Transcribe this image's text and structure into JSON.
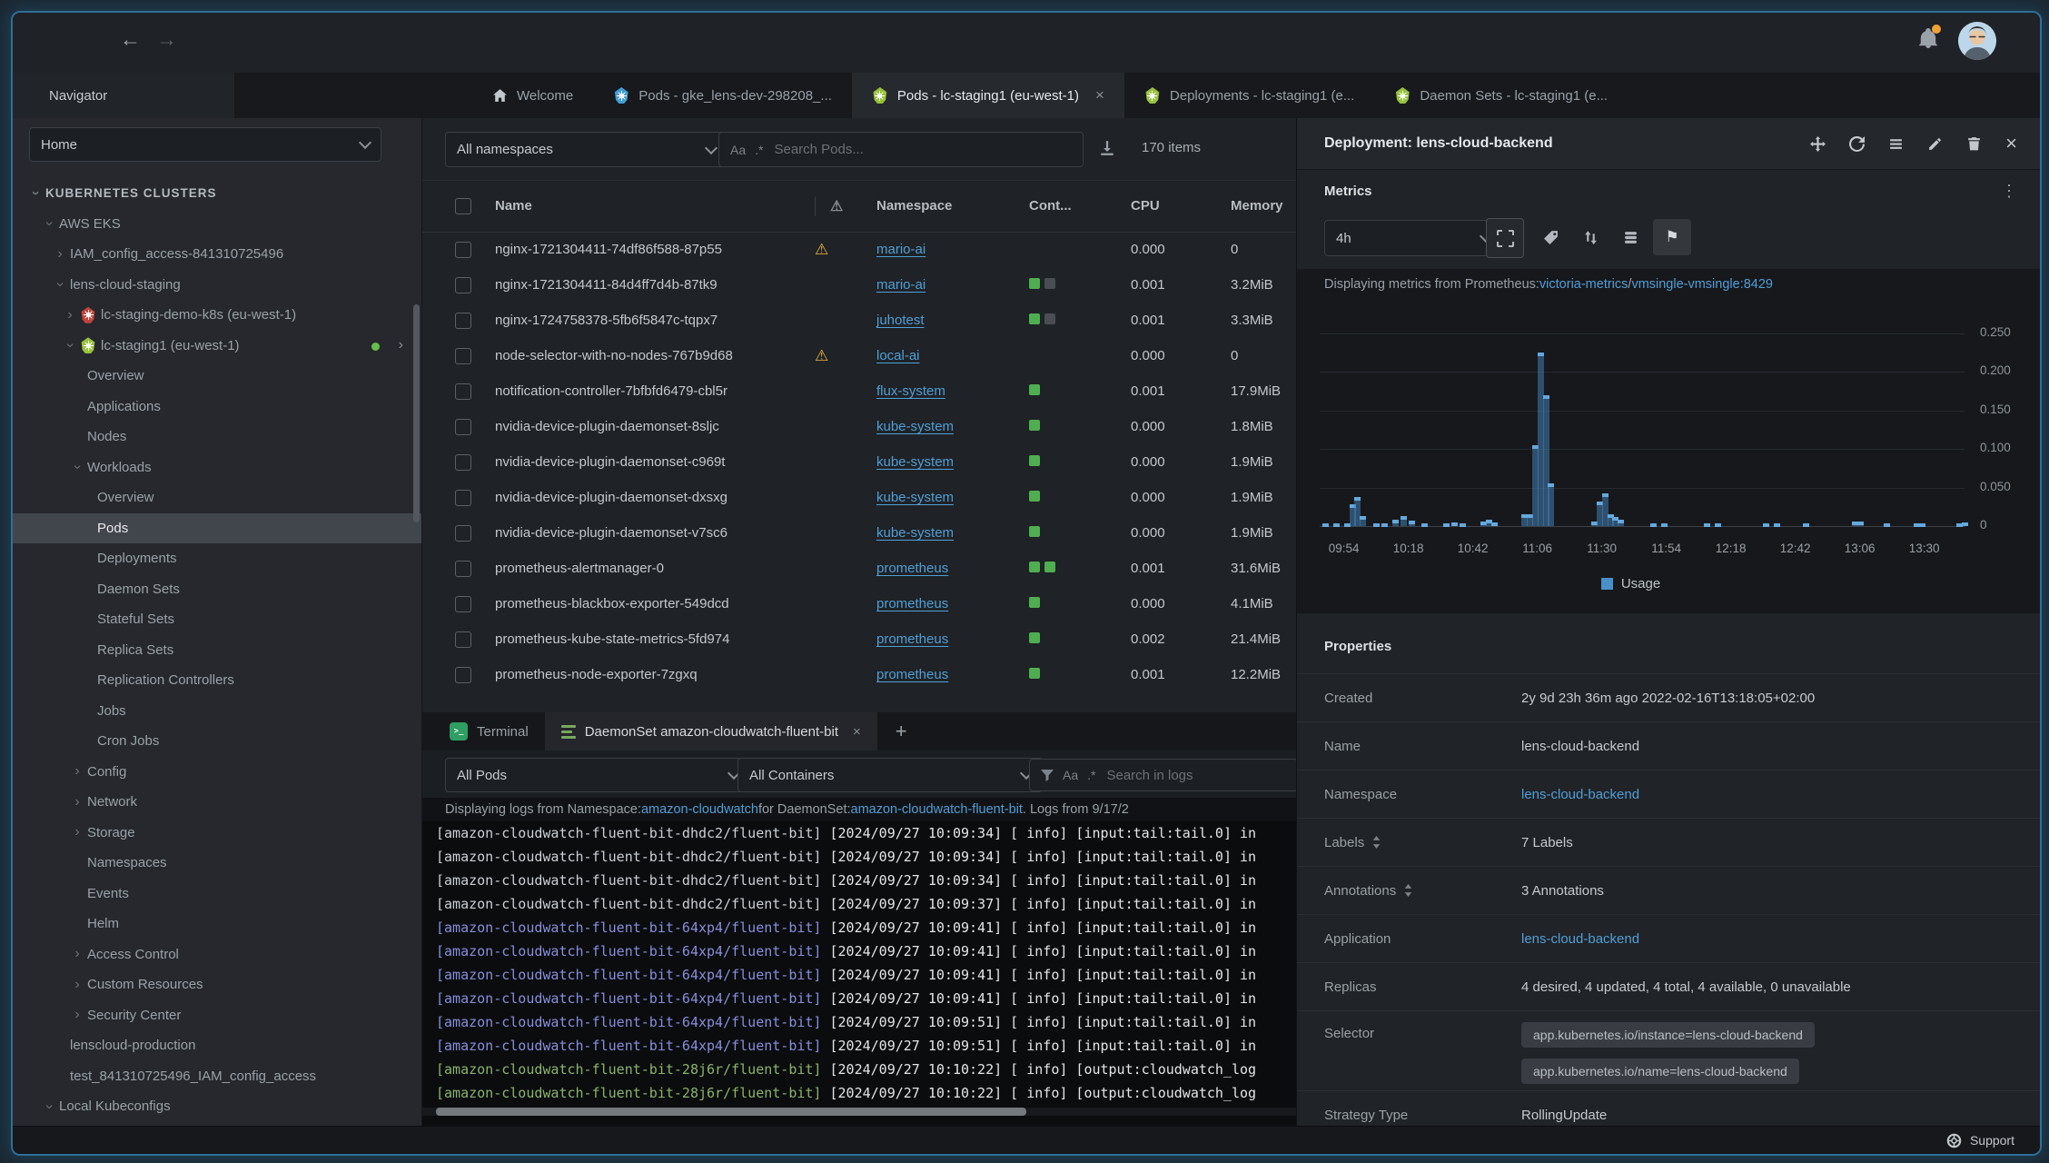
{
  "chart_data": {
    "type": "bar",
    "title": "",
    "xlabel": "",
    "ylabel": "",
    "ylim": [
      0,
      0.25
    ],
    "yticks": [
      "0.250",
      "0.200",
      "0.150",
      "0.100",
      "0.050",
      "0"
    ],
    "ytick_values": [
      0.25,
      0.2,
      0.15,
      0.1,
      0.05,
      0
    ],
    "xticks": [
      "09:54",
      "10:18",
      "10:42",
      "11:06",
      "11:30",
      "11:54",
      "12:18",
      "12:42",
      "13:06",
      "13:30"
    ],
    "x_window": [
      "09:45",
      "13:45"
    ],
    "grid": true,
    "legend_position": "bottom",
    "legend": [
      {
        "label": "Usage",
        "color": "#4a90c8"
      }
    ],
    "series": [
      {
        "name": "Usage",
        "points": [
          [
            "09:47",
            0.002
          ],
          [
            "09:51",
            0.002
          ],
          [
            "09:55",
            0.004
          ],
          [
            "09:57",
            0.028
          ],
          [
            "09:59",
            0.038
          ],
          [
            "10:01",
            0.013
          ],
          [
            "10:06",
            0.004
          ],
          [
            "10:09",
            0.004
          ],
          [
            "10:13",
            0.008
          ],
          [
            "10:16",
            0.013
          ],
          [
            "10:19",
            0.007
          ],
          [
            "10:24",
            0.003
          ],
          [
            "10:32",
            0.004
          ],
          [
            "10:35",
            0.005
          ],
          [
            "10:38",
            0.004
          ],
          [
            "10:46",
            0.006
          ],
          [
            "10:48",
            0.008
          ],
          [
            "10:50",
            0.005
          ],
          [
            "11:01",
            0.015
          ],
          [
            "11:03",
            0.015
          ],
          [
            "11:05",
            0.105
          ],
          [
            "11:07",
            0.225
          ],
          [
            "11:09",
            0.17
          ],
          [
            "11:11",
            0.055
          ],
          [
            "11:27",
            0.006
          ],
          [
            "11:29",
            0.032
          ],
          [
            "11:31",
            0.042
          ],
          [
            "11:33",
            0.015
          ],
          [
            "11:35",
            0.012
          ],
          [
            "11:37",
            0.008
          ],
          [
            "11:49",
            0.003
          ],
          [
            "11:53",
            0.003
          ],
          [
            "12:09",
            0.003
          ],
          [
            "12:13",
            0.003
          ],
          [
            "12:31",
            0.003
          ],
          [
            "12:35",
            0.003
          ],
          [
            "12:46",
            0.003
          ],
          [
            "13:04",
            0.006
          ],
          [
            "13:06",
            0.006
          ],
          [
            "13:16",
            0.003
          ],
          [
            "13:27",
            0.003
          ],
          [
            "13:29",
            0.003
          ],
          [
            "13:43",
            0.004
          ],
          [
            "13:45",
            0.005
          ]
        ]
      }
    ]
  },
  "header": {
    "back_icon": "←",
    "forward_icon": "→"
  },
  "tabs": {
    "navigator_label": "Navigator",
    "items": [
      {
        "icon": "home",
        "label": "Welcome"
      },
      {
        "icon": "k8s-blue",
        "label": "Pods - gke_lens-dev-298208_..."
      },
      {
        "icon": "k8s-green",
        "label": "Pods - lc-staging1 (eu-west-1)",
        "active": true,
        "closable": true
      },
      {
        "icon": "k8s-green",
        "label": "Deployments - lc-staging1 (e..."
      },
      {
        "icon": "k8s-green",
        "label": "Daemon Sets - lc-staging1 (e..."
      }
    ]
  },
  "sidebar": {
    "selector_value": "Home",
    "tree": [
      {
        "level": 0,
        "chevron": "open",
        "label": "KUBERNETES CLUSTERS",
        "group": true
      },
      {
        "level": 1,
        "chevron": "open",
        "label": "AWS EKS"
      },
      {
        "level": 2,
        "chevron": "closed",
        "label": "IAM_config_access-841310725496"
      },
      {
        "level": 2,
        "chevron": "open",
        "label": "lens-cloud-staging"
      },
      {
        "level": 3,
        "chevron": "closed",
        "icon": "red",
        "label": "lc-staging-demo-k8s (eu-west-1)"
      },
      {
        "level": 3,
        "chevron": "open",
        "icon": "green",
        "label": "lc-staging1 (eu-west-1)",
        "status_dot": true,
        "arrow": true
      },
      {
        "level": 4,
        "label": "Overview"
      },
      {
        "level": 4,
        "label": "Applications"
      },
      {
        "level": 4,
        "label": "Nodes"
      },
      {
        "level": 4,
        "chevron": "open",
        "label": "Workloads"
      },
      {
        "level": 5,
        "label": "Overview"
      },
      {
        "level": 5,
        "label": "Pods",
        "selected": true
      },
      {
        "level": 5,
        "label": "Deployments"
      },
      {
        "level": 5,
        "label": "Daemon Sets"
      },
      {
        "level": 5,
        "label": "Stateful Sets"
      },
      {
        "level": 5,
        "label": "Replica Sets"
      },
      {
        "level": 5,
        "label": "Replication Controllers"
      },
      {
        "level": 5,
        "label": "Jobs"
      },
      {
        "level": 5,
        "label": "Cron Jobs"
      },
      {
        "level": 4,
        "chevron": "closed",
        "label": "Config"
      },
      {
        "level": 4,
        "chevron": "closed",
        "label": "Network"
      },
      {
        "level": 4,
        "chevron": "closed",
        "label": "Storage"
      },
      {
        "level": 4,
        "label": "Namespaces"
      },
      {
        "level": 4,
        "label": "Events"
      },
      {
        "level": 4,
        "label": "Helm"
      },
      {
        "level": 4,
        "chevron": "closed",
        "label": "Access Control"
      },
      {
        "level": 4,
        "chevron": "closed",
        "label": "Custom Resources"
      },
      {
        "level": 4,
        "chevron": "closed",
        "label": "Security Center"
      },
      {
        "level": 2,
        "label": "lenscloud-production"
      },
      {
        "level": 2,
        "label": "test_841310725496_IAM_config_access"
      },
      {
        "level": 1,
        "chevron": "open",
        "label": "Local Kubeconfigs"
      }
    ]
  },
  "pods": {
    "namespace_filter": "All namespaces",
    "search_placeholder": "Search Pods...",
    "case_icon": "Aa",
    "regex_icon": ".*",
    "items_count": "170 items",
    "columns": [
      "Name",
      "Namespace",
      "Cont...",
      "CPU",
      "Memory"
    ],
    "rows": [
      {
        "name": "nginx-1721304411-74df86f588-87p55",
        "warning": true,
        "namespace": "mario-ai",
        "containers": [],
        "cpu": "0.000",
        "memory": "0"
      },
      {
        "name": "nginx-1721304411-84d4ff7d4b-87tk9",
        "warning": false,
        "namespace": "mario-ai",
        "containers": [
          "on",
          "off"
        ],
        "cpu": "0.001",
        "memory": "3.2MiB"
      },
      {
        "name": "nginx-1724758378-5fb6f5847c-tqpx7",
        "warning": false,
        "namespace": "juhotest",
        "containers": [
          "on",
          "off"
        ],
        "cpu": "0.001",
        "memory": "3.3MiB"
      },
      {
        "name": "node-selector-with-no-nodes-767b9d68",
        "warning": true,
        "namespace": "local-ai",
        "containers": [],
        "cpu": "0.000",
        "memory": "0"
      },
      {
        "name": "notification-controller-7bfbfd6479-cbl5r",
        "warning": false,
        "namespace": "flux-system",
        "containers": [
          "on"
        ],
        "cpu": "0.001",
        "memory": "17.9MiB"
      },
      {
        "name": "nvidia-device-plugin-daemonset-8sljc",
        "warning": false,
        "namespace": "kube-system",
        "containers": [
          "on"
        ],
        "cpu": "0.000",
        "memory": "1.8MiB"
      },
      {
        "name": "nvidia-device-plugin-daemonset-c969t",
        "warning": false,
        "namespace": "kube-system",
        "containers": [
          "on"
        ],
        "cpu": "0.000",
        "memory": "1.9MiB"
      },
      {
        "name": "nvidia-device-plugin-daemonset-dxsxg",
        "warning": false,
        "namespace": "kube-system",
        "containers": [
          "on"
        ],
        "cpu": "0.000",
        "memory": "1.9MiB"
      },
      {
        "name": "nvidia-device-plugin-daemonset-v7sc6",
        "warning": false,
        "namespace": "kube-system",
        "containers": [
          "on"
        ],
        "cpu": "0.000",
        "memory": "1.9MiB"
      },
      {
        "name": "prometheus-alertmanager-0",
        "warning": false,
        "namespace": "prometheus",
        "containers": [
          "on",
          "on"
        ],
        "cpu": "0.001",
        "memory": "31.6MiB"
      },
      {
        "name": "prometheus-blackbox-exporter-549dcd",
        "warning": false,
        "namespace": "prometheus",
        "containers": [
          "on"
        ],
        "cpu": "0.000",
        "memory": "4.1MiB"
      },
      {
        "name": "prometheus-kube-state-metrics-5fd974",
        "warning": false,
        "namespace": "prometheus",
        "containers": [
          "on"
        ],
        "cpu": "0.002",
        "memory": "21.4MiB"
      },
      {
        "name": "prometheus-node-exporter-7zgxq",
        "warning": false,
        "namespace": "prometheus",
        "containers": [
          "on"
        ],
        "cpu": "0.001",
        "memory": "12.2MiB"
      }
    ]
  },
  "dock": {
    "tabs": [
      {
        "icon": "terminal",
        "label": "Terminal"
      },
      {
        "icon": "logs",
        "label": "DaemonSet amazon-cloudwatch-fluent-bit",
        "active": true,
        "closable": true
      }
    ],
    "new_tab_icon": "+",
    "pod_filter": "All Pods",
    "container_filter": "All Containers",
    "search_placeholder": "Search in logs",
    "case_icon": "Aa",
    "regex_icon": ".*",
    "info": {
      "prefix": "Displaying logs from Namespace: ",
      "namespace_link": "amazon-cloudwatch",
      "middle": " for DaemonSet: ",
      "daemonset_link": "amazon-cloudwatch-fluent-bit",
      "suffix": ". Logs from 9/17/2"
    },
    "logs": [
      {
        "prefix": "[amazon-cloudwatch-fluent-bit-dhdc2/fluent-bit]",
        "color": "#ccd0d4",
        "message": " [2024/09/27 10:09:34] [ info] [input:tail:tail.0] in"
      },
      {
        "prefix": "[amazon-cloudwatch-fluent-bit-dhdc2/fluent-bit]",
        "color": "#ccd0d4",
        "message": " [2024/09/27 10:09:34] [ info] [input:tail:tail.0] in"
      },
      {
        "prefix": "[amazon-cloudwatch-fluent-bit-dhdc2/fluent-bit]",
        "color": "#ccd0d4",
        "message": " [2024/09/27 10:09:34] [ info] [input:tail:tail.0] in"
      },
      {
        "prefix": "[amazon-cloudwatch-fluent-bit-dhdc2/fluent-bit]",
        "color": "#ccd0d4",
        "message": " [2024/09/27 10:09:37] [ info] [input:tail:tail.0] in"
      },
      {
        "prefix": "[amazon-cloudwatch-fluent-bit-64xp4/fluent-bit]",
        "color": "#8a8edb",
        "message": " [2024/09/27 10:09:41] [ info] [input:tail:tail.0] in"
      },
      {
        "prefix": "[amazon-cloudwatch-fluent-bit-64xp4/fluent-bit]",
        "color": "#8a8edb",
        "message": " [2024/09/27 10:09:41] [ info] [input:tail:tail.0] in"
      },
      {
        "prefix": "[amazon-cloudwatch-fluent-bit-64xp4/fluent-bit]",
        "color": "#8a8edb",
        "message": " [2024/09/27 10:09:41] [ info] [input:tail:tail.0] in"
      },
      {
        "prefix": "[amazon-cloudwatch-fluent-bit-64xp4/fluent-bit]",
        "color": "#8a8edb",
        "message": " [2024/09/27 10:09:41] [ info] [input:tail:tail.0] in"
      },
      {
        "prefix": "[amazon-cloudwatch-fluent-bit-64xp4/fluent-bit]",
        "color": "#8a8edb",
        "message": " [2024/09/27 10:09:51] [ info] [input:tail:tail.0] in"
      },
      {
        "prefix": "[amazon-cloudwatch-fluent-bit-64xp4/fluent-bit]",
        "color": "#8a8edb",
        "message": " [2024/09/27 10:09:51] [ info] [input:tail:tail.0] in"
      },
      {
        "prefix": "[amazon-cloudwatch-fluent-bit-28j6r/fluent-bit]",
        "color": "#8cb46a",
        "message": " [2024/09/27 10:10:22] [ info] [output:cloudwatch_log"
      },
      {
        "prefix": "[amazon-cloudwatch-fluent-bit-28j6r/fluent-bit]",
        "color": "#8cb46a",
        "message": " [2024/09/27 10:10:22] [ info] [output:cloudwatch_log"
      }
    ]
  },
  "drawer": {
    "title": "Deployment: lens-cloud-backend",
    "metrics_title": "Metrics",
    "range_value": "4h",
    "source": {
      "prefix": "Displaying metrics from Prometheus: ",
      "link1": "victoria-metrics",
      "sep": " / ",
      "link2": "vmsingle-vmsingle:8429"
    },
    "properties_title": "Properties",
    "properties": [
      {
        "label": "Created",
        "value": "2y 9d 23h 36m ago 2022-02-16T13:18:05+02:00"
      },
      {
        "label": "Name",
        "value": "lens-cloud-backend"
      },
      {
        "label": "Namespace",
        "value": "lens-cloud-backend",
        "link": true
      },
      {
        "label": "Labels",
        "value": "7 Labels",
        "sort": true
      },
      {
        "label": "Annotations",
        "value": "3 Annotations",
        "sort": true
      },
      {
        "label": "Application",
        "value": "lens-cloud-backend",
        "link": true
      },
      {
        "label": "Replicas",
        "value": "4 desired, 4 updated, 4 total, 4 available, 0 unavailable"
      },
      {
        "label": "Selector",
        "badges": [
          "app.kubernetes.io/instance=lens-cloud-backend",
          "app.kubernetes.io/name=lens-cloud-backend"
        ]
      },
      {
        "label": "Strategy Type",
        "value": "RollingUpdate"
      }
    ]
  },
  "status": {
    "support_label": "Support"
  }
}
